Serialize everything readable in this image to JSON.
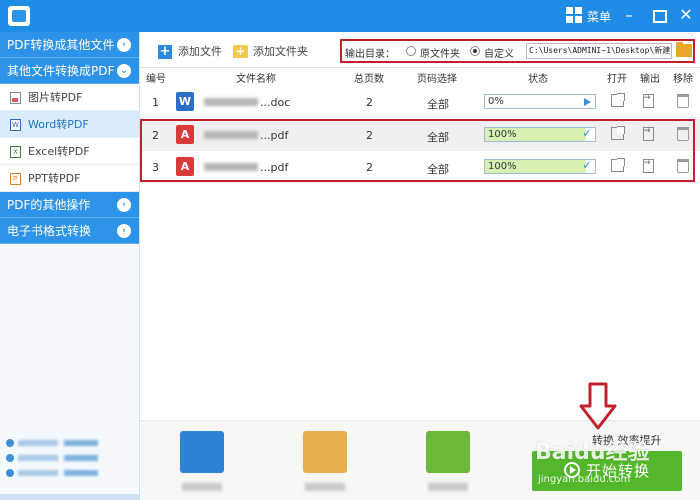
{
  "titlebar": {
    "app_title": "",
    "menu_label": "菜单",
    "minimize": "–",
    "close": "✕"
  },
  "sidebar": {
    "categories": [
      {
        "label": "PDF转换成其他文件"
      },
      {
        "label": "其他文件转换成PDF"
      },
      {
        "label": "PDF的其他操作"
      },
      {
        "label": "电子书格式转换"
      }
    ],
    "items": [
      {
        "label": "图片转PDF",
        "icon": "image-icon"
      },
      {
        "label": "Word转PDF",
        "icon": "word-icon"
      },
      {
        "label": "Excel转PDF",
        "icon": "excel-icon"
      },
      {
        "label": "PPT转PDF",
        "icon": "ppt-icon"
      }
    ]
  },
  "toolbar": {
    "add_file": "添加文件",
    "add_folder": "添加文件夹",
    "output_label": "输出目录：",
    "radio_original": "原文件夹",
    "radio_custom": "自定义",
    "output_path": "C:\\Users\\ADMINI~1\\Desktop\\新建文"
  },
  "table": {
    "headers": {
      "index": "编号",
      "name": "文件名称",
      "pages": "总页数",
      "range": "页码选择",
      "status": "状态",
      "open": "打开",
      "export": "输出",
      "remove": "移除"
    },
    "rows": [
      {
        "index": "1",
        "type": "W",
        "ext": "...doc",
        "pages": "2",
        "range": "全部",
        "progress_text": "0%",
        "progress": 0
      },
      {
        "index": "2",
        "type": "A",
        "ext": "...pdf",
        "pages": "2",
        "range": "全部",
        "progress_text": "100%",
        "progress": 100
      },
      {
        "index": "3",
        "type": "A",
        "ext": "...pdf",
        "pages": "2",
        "range": "全部",
        "progress_text": "100%",
        "progress": 100
      }
    ]
  },
  "bottom": {
    "slogan": "转换 效率提升",
    "start_button": "开始转换"
  },
  "watermark": {
    "main": "Baidu经验",
    "sub": "jingyan.baidu.com"
  },
  "colors": {
    "accent": "#1f8de6",
    "highlight": "#c0212c",
    "start_green": "#54b72b"
  }
}
